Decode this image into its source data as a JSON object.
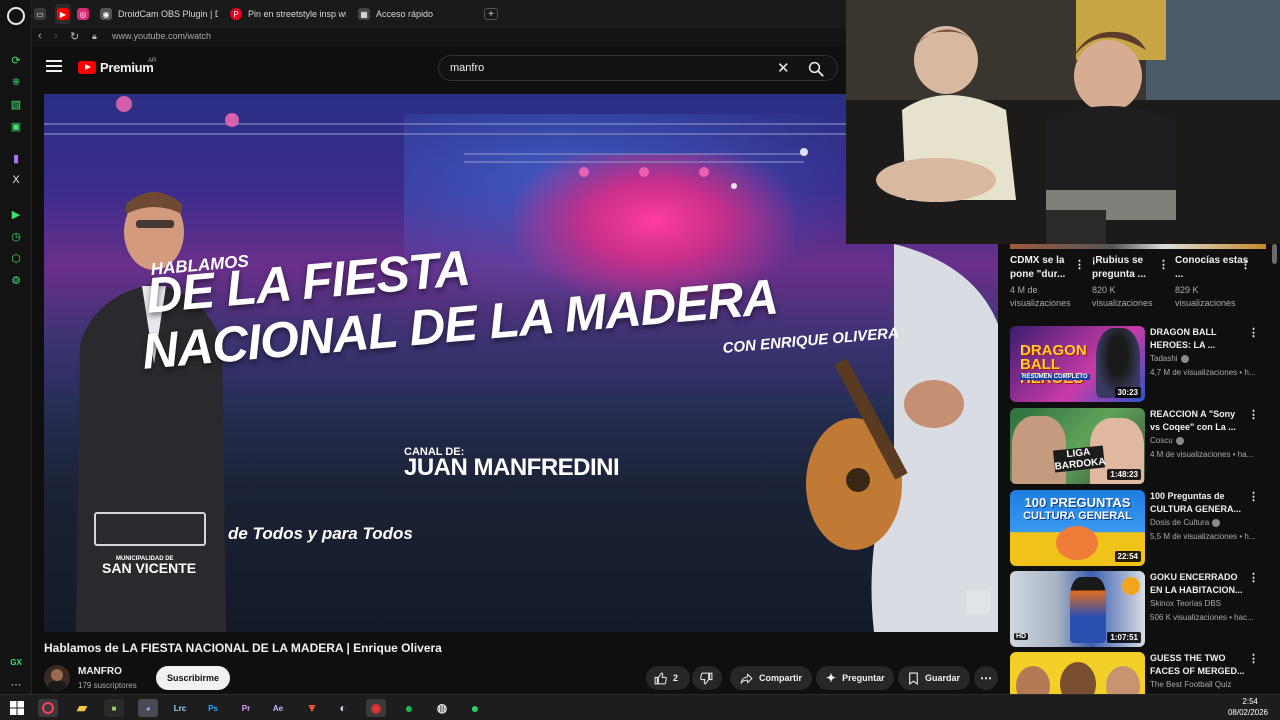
{
  "browser": {
    "tabs": [
      {
        "label": "",
        "icon": "youtube-icon",
        "color": "#ff0000"
      },
      {
        "label": "",
        "icon": "instagram-icon",
        "color": "#d62976"
      },
      {
        "label": "DroidCam OBS Plugin | De",
        "icon": "droidcam-icon",
        "color": "#555555"
      },
      {
        "label": "Pin en streetstyle insp wit",
        "icon": "pinterest-icon",
        "color": "#e60023"
      },
      {
        "label": "Acceso rápido",
        "icon": "grid-icon",
        "color": "#444444"
      }
    ],
    "url": "www.youtube.com/watch"
  },
  "youtube": {
    "logo_text": "Premium",
    "country_code": "AR",
    "search_value": "manfro"
  },
  "video": {
    "overlay": {
      "line1": "HABLAMOS",
      "line2": "DE LA FIESTA",
      "line3": "NACIONAL DE LA MADERA",
      "line4": "CON ENRIQUE OLIVERA",
      "canal_label": "CANAL DE:",
      "canal_name": "JUAN MANFREDINI",
      "muni_label": "MUNICIPALIDAD DE",
      "muni_name": "SAN VICENTE",
      "slogan": "de Todos y para Todos"
    },
    "title": "Hablamos de LA FIESTA NACIONAL DE LA MADERA | Enrique Olivera",
    "channel": "MANFRO",
    "subscribers": "179 suscriptores",
    "subscribe_label": "Suscribirme",
    "likes": "2",
    "share_label": "Compartir",
    "ask_label": "Preguntar",
    "save_label": "Guardar"
  },
  "shorts": [
    {
      "title": "CDMX se la pone \"dur...",
      "views": "4 M de visualizaciones"
    },
    {
      "title": "¡Rubius se pregunta ...",
      "views": "820 K visualizaciones"
    },
    {
      "title": "Conocías estas ...",
      "views": "829 K visualizaciones"
    }
  ],
  "recommendations": [
    {
      "title": "DRAGON BALL HEROES: LA ...",
      "channel": "Tadashi",
      "verified": true,
      "meta": "4,7 M de visualizaciones • h...",
      "duration": "30:23",
      "thumb_text": "DRAGON BALL HEROES",
      "thumb_sub": "RESUMEN COMPLETO",
      "color1": "#3b1d6e",
      "color2": "#c93aa8"
    },
    {
      "title": "REACCION A \"Sony vs Coqee\" con La ...",
      "channel": "Coscu",
      "verified": true,
      "meta": "4 M de visualizaciones • ha...",
      "duration": "1:48:23",
      "thumb_text": "LIGA BARDOKA",
      "thumb_sub": "",
      "color1": "#2d6e3e",
      "color2": "#5fa35a"
    },
    {
      "title": "100 Preguntas de CULTURA GENERA...",
      "channel": "Dosis de Cultura",
      "verified": true,
      "meta": "5,5 M de visualizaciones • h...",
      "duration": "22:54",
      "thumb_text": "100 PREGUNTAS",
      "thumb_sub": "CULTURA GENERAL",
      "color1": "#1e7ce0",
      "color2": "#f0c21a"
    },
    {
      "title": "GOKU ENCERRADO EN LA HABITACION...",
      "channel": "Skinox Teorías DBS",
      "verified": false,
      "meta": "506 K visualizaciones • hac...",
      "duration": "1:07:51",
      "thumb_text": "",
      "thumb_sub": "",
      "color1": "#a9b4c4",
      "color2": "#3b5fb0",
      "badge": "HD"
    },
    {
      "title": "GUESS THE TWO FACES OF MERGED...",
      "channel": "The Best Football Quiz",
      "verified": false,
      "meta": "",
      "duration": "",
      "thumb_text": "",
      "thumb_sub": "",
      "color1": "#f2d027",
      "color2": "#1b4fa8"
    }
  ],
  "taskbar": {
    "apps": [
      "Lrc",
      "Ps",
      "Pr",
      "Ae"
    ],
    "time": "2:54",
    "date": "08/02/2026"
  },
  "colors": {
    "accent_gx": "#3fe36d",
    "yt_red": "#ff0000"
  }
}
